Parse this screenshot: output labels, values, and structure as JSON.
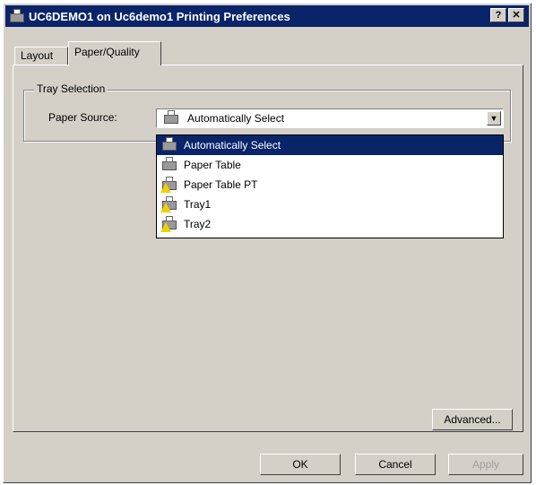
{
  "window": {
    "title": "UC6DEMO1 on Uc6demo1 Printing Preferences",
    "help_button": "?",
    "close_button": "✕"
  },
  "tabs": [
    {
      "label": "Layout",
      "active": false
    },
    {
      "label": "Paper/Quality",
      "active": true
    }
  ],
  "tray_selection": {
    "group_label": "Tray Selection",
    "paper_source_label": "Paper Source:",
    "selected_value": "Automatically Select",
    "options": [
      {
        "label": "Automatically Select",
        "icon": "printer-icon",
        "selected": true
      },
      {
        "label": "Paper Table",
        "icon": "printer-icon",
        "selected": false
      },
      {
        "label": "Paper Table PT",
        "icon": "printer-warning-icon",
        "selected": false
      },
      {
        "label": "Tray1",
        "icon": "printer-warning-icon",
        "selected": false
      },
      {
        "label": "Tray2",
        "icon": "printer-warning-icon",
        "selected": false
      }
    ]
  },
  "buttons": {
    "advanced": "Advanced...",
    "ok": "OK",
    "cancel": "Cancel",
    "apply": "Apply"
  },
  "colors": {
    "title_bar": "#0a246a",
    "selection": "#0a246a",
    "face": "#d4d0c8"
  }
}
